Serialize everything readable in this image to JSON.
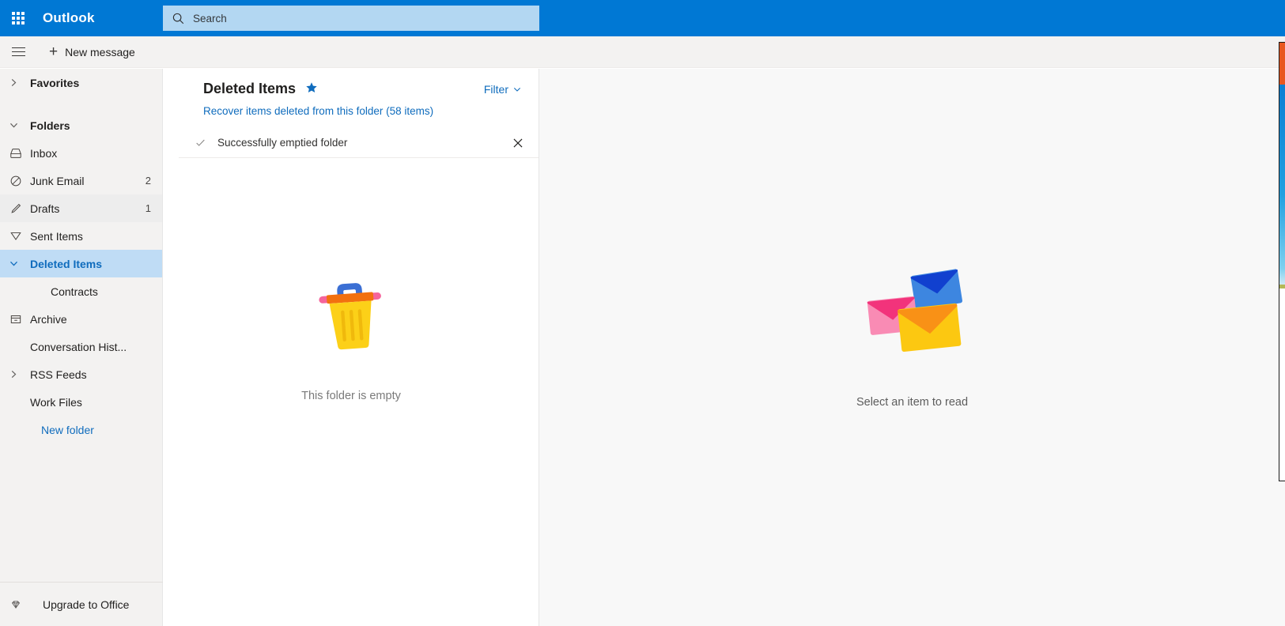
{
  "app": {
    "brand": "Outlook",
    "accent_color": "#0078d4",
    "search_field_color": "#b3d7f2",
    "selection_color": "#bfdcf5",
    "link_color": "#0f6cbd"
  },
  "header": {
    "waffle_icon": "app-launcher-waffle-icon",
    "search": {
      "icon": "search-icon",
      "placeholder": "Search",
      "value": ""
    }
  },
  "commandbar": {
    "menu_icon": "hamburger-menu-icon",
    "new_message": {
      "plus": "+",
      "label": "New message"
    }
  },
  "sidebar": {
    "groups": [
      {
        "label": "Favorites",
        "chevron": "chevron-right",
        "expanded": false
      },
      {
        "label": "Folders",
        "chevron": "chevron-down",
        "expanded": true
      }
    ],
    "items": [
      {
        "label": "Inbox",
        "icon": "inbox-icon",
        "count": "",
        "state": "normal",
        "indent": "icon"
      },
      {
        "label": "Junk Email",
        "icon": "block-icon",
        "count": "2",
        "state": "normal",
        "indent": "icon"
      },
      {
        "label": "Drafts",
        "icon": "pencil-icon",
        "count": "1",
        "state": "hover",
        "indent": "icon"
      },
      {
        "label": "Sent Items",
        "icon": "send-icon",
        "count": "",
        "state": "normal",
        "indent": "icon"
      },
      {
        "label": "Deleted Items",
        "icon": "chevron-down",
        "count": "",
        "state": "selected",
        "indent": "chevron"
      },
      {
        "label": "Contracts",
        "icon": "",
        "count": "",
        "state": "normal",
        "indent": "child"
      },
      {
        "label": "Archive",
        "icon": "archive-icon",
        "count": "",
        "state": "normal",
        "indent": "icon"
      },
      {
        "label": "Conversation Hist...",
        "icon": "",
        "count": "",
        "state": "normal",
        "indent": "blank"
      },
      {
        "label": "RSS Feeds",
        "icon": "chevron-right",
        "count": "",
        "state": "normal",
        "indent": "chevron"
      },
      {
        "label": "Work Files",
        "icon": "",
        "count": "",
        "state": "normal",
        "indent": "blank"
      },
      {
        "label": "New folder",
        "icon": "",
        "count": "",
        "state": "link",
        "indent": "newfolder"
      }
    ],
    "footer": {
      "icon": "diamond-icon",
      "label": "Upgrade to Office"
    }
  },
  "message_list": {
    "folder_title": "Deleted Items",
    "favorite_icon": "star-filled-icon",
    "filter": {
      "label": "Filter",
      "chevron_icon": "chevron-down-icon"
    },
    "recover_link": "Recover items deleted from this folder (58 items)",
    "notification": {
      "check_icon": "checkmark-icon",
      "text": "Successfully emptied folder",
      "close_icon": "close-icon"
    },
    "empty_state": {
      "illustration": "empty-trash-can-illustration",
      "caption": "This folder is empty"
    }
  },
  "reading_pane": {
    "empty_state": {
      "illustration": "three-envelopes-illustration",
      "caption": "Select an item to read"
    }
  },
  "edge_window": {
    "name": "partially-visible-background-window"
  }
}
